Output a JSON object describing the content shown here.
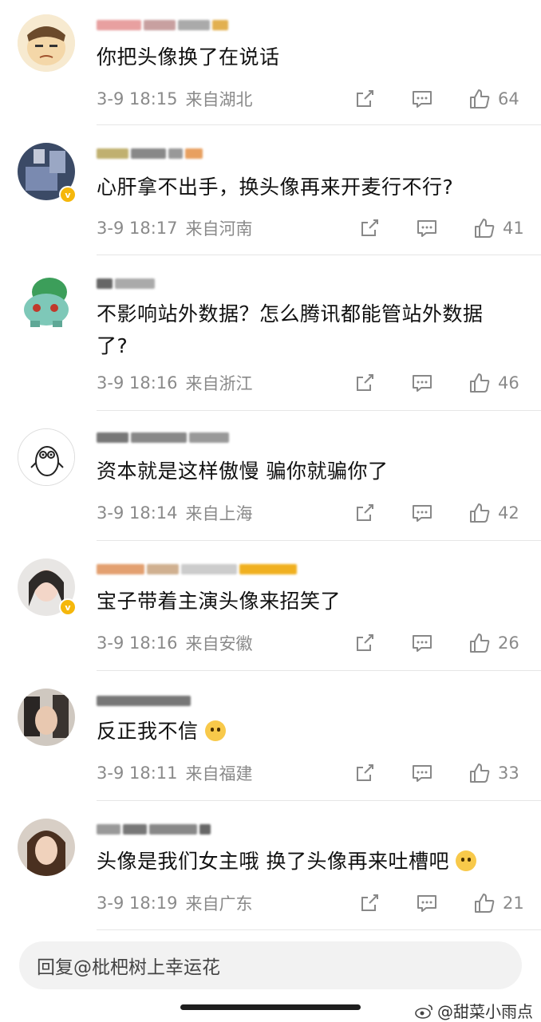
{
  "comments": [
    {
      "text": "你把头像换了在说话",
      "time": "3-9 18:15",
      "location": "来自湖北",
      "likes": "64",
      "verified": false
    },
    {
      "text": "心肝拿不出手，换头像再来开麦行不行?",
      "time": "3-9 18:17",
      "location": "来自河南",
      "likes": "41",
      "verified": true
    },
    {
      "text": "不影响站外数据？怎么腾讯都能管站外数据了?",
      "time": "3-9 18:16",
      "location": "来自浙江",
      "likes": "46",
      "verified": false
    },
    {
      "text": "资本就是这样傲慢 骗你就骗你了",
      "time": "3-9 18:14",
      "location": "来自上海",
      "likes": "42",
      "verified": false
    },
    {
      "text": "宝子带着主演头像来招笑了",
      "time": "3-9 18:16",
      "location": "来自安徽",
      "likes": "26",
      "verified": true
    },
    {
      "text": "反正我不信",
      "time": "3-9 18:11",
      "location": "来自福建",
      "likes": "33",
      "verified": false
    },
    {
      "text": "头像是我们女主哦 换了头像再来吐槽吧",
      "time": "3-9 18:19",
      "location": "来自广东",
      "likes": "21",
      "verified": false
    }
  ],
  "reply_box": {
    "placeholder": "回复@枇杷树上幸运花"
  },
  "watermark": {
    "text": "@甜菜小雨点"
  },
  "colors": {
    "meta": "#8a8a8a",
    "divider": "#e6e6e6",
    "verified_badge": "#f5b70b"
  }
}
